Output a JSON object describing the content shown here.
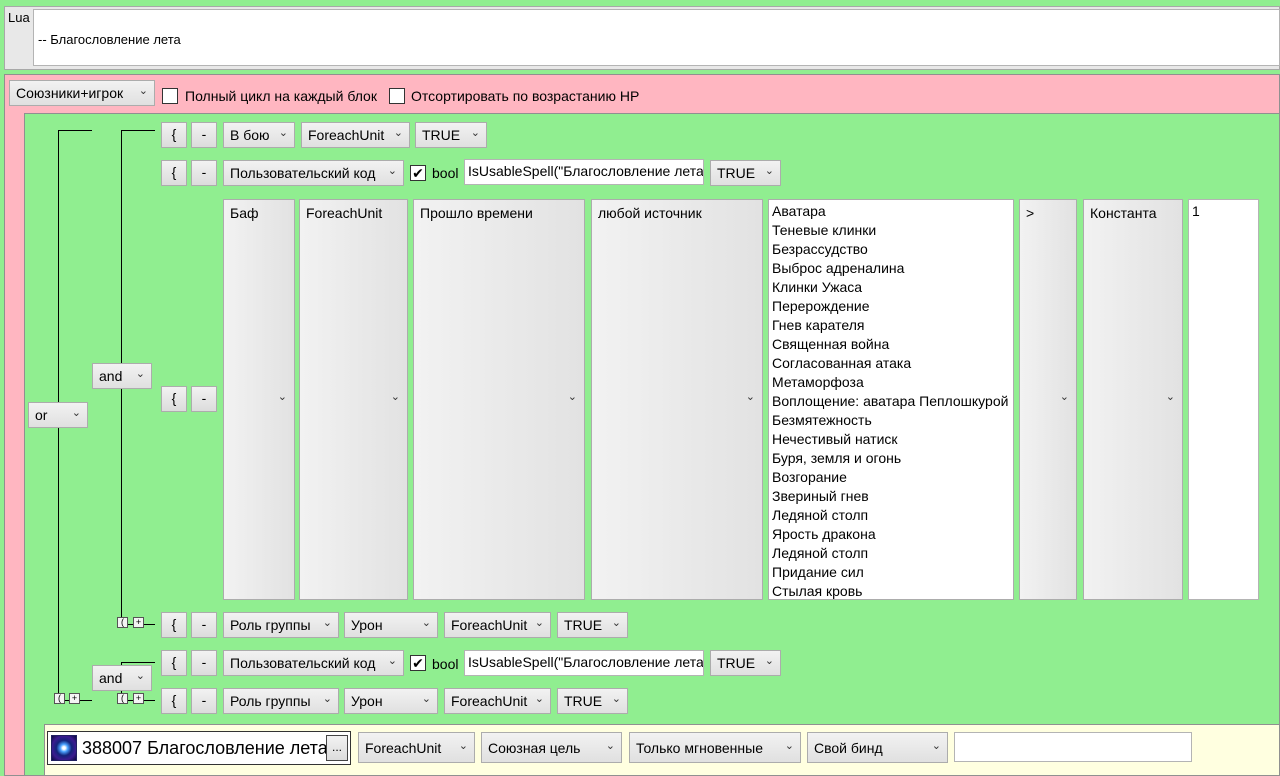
{
  "lua": {
    "label": "Lua",
    "code": "-- Благословление лета"
  },
  "header": {
    "target_select": "Союзники+игрок",
    "full_cycle_label": "Полный цикл на каждый блок",
    "full_cycle_checked": false,
    "sort_hp_label": "Отсортировать по возрастанию HP",
    "sort_hp_checked": false
  },
  "logic": {
    "or": "or",
    "and1": "and",
    "and2": "and"
  },
  "glyphs": {
    "brace": "{",
    "minus": "-",
    "small_brace": "(",
    "small_plus": "+",
    "check": "✔",
    "chev": "⌄",
    "more": "..."
  },
  "rows": {
    "r1": {
      "cond": "В бою",
      "unit": "ForeachUnit",
      "value": "TRUE"
    },
    "r2": {
      "cond": "Пользовательский код",
      "bool_label": "bool",
      "bool_checked": true,
      "code": "IsUsableSpell(\"Благословление лета\")",
      "value": "TRUE"
    },
    "r3": {
      "cond": "Баф",
      "unit": "ForeachUnit",
      "time": "Прошло времени",
      "source": "любой источник",
      "spells": [
        "Аватара",
        "Теневые клинки",
        "Безрассудство",
        "Выброс адреналина",
        "Клинки Ужаса",
        "Перерождение",
        "Гнев карателя",
        "Священная война",
        "Согласованная атака",
        "Метаморфоза",
        "Воплощение: аватара Пеплошкурой",
        "Безмятежность",
        "Нечестивый натиск",
        "Буря, земля и огонь",
        "Возгорание",
        "Звериный гнев",
        "Ледяной столп",
        "Ярость дракона",
        "Ледяной столп",
        "Придание сил",
        "Стылая кровь"
      ],
      "operator": ">",
      "value_type": "Константа",
      "value": "1"
    },
    "r4": {
      "cond": "Роль группы",
      "role": "Урон",
      "unit": "ForeachUnit",
      "value": "TRUE"
    },
    "r5": {
      "cond": "Пользовательский код",
      "bool_label": "bool",
      "bool_checked": true,
      "code": "IsUsableSpell(\"Благословление лета\")",
      "value": "TRUE"
    },
    "r6": {
      "cond": "Роль группы",
      "role": "Урон",
      "unit": "ForeachUnit",
      "value": "TRUE"
    }
  },
  "action": {
    "spell": "388007 Благословление лета",
    "unit": "ForeachUnit",
    "target": "Союзная цель",
    "cast_type": "Только мгновенные",
    "bind": "Свой бинд",
    "bind_value": ""
  }
}
